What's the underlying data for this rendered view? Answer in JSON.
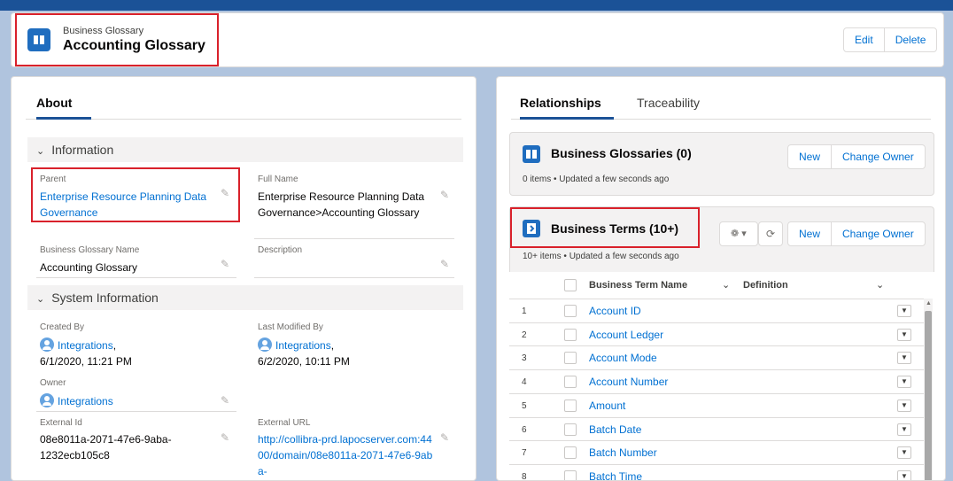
{
  "header": {
    "subtitle": "Business Glossary",
    "title": "Accounting Glossary",
    "edit_label": "Edit",
    "delete_label": "Delete"
  },
  "left": {
    "tab": "About",
    "information": {
      "heading": "Information",
      "parent_label": "Parent",
      "parent_value": "Enterprise Resource Planning Data Governance",
      "full_name_label": "Full Name",
      "full_name_value": "Enterprise Resource Planning Data Governance>Accounting Glossary",
      "glossary_name_label": "Business Glossary Name",
      "glossary_name_value": "Accounting Glossary",
      "description_label": "Description"
    },
    "system": {
      "heading": "System Information",
      "created_by_label": "Created By",
      "created_by_user": "Integrations",
      "created_by_date": "6/1/2020, 11:21 PM",
      "modified_by_label": "Last Modified By",
      "modified_by_user": "Integrations",
      "modified_by_date": "6/2/2020, 10:11 PM",
      "owner_label": "Owner",
      "owner_value": "Integrations",
      "external_id_label": "External Id",
      "external_id_value": "08e8011a-2071-47e6-9aba-1232ecb105c8",
      "external_url_label": "External URL",
      "external_url_value": "http://collibra-prd.lapocserver.com:4400/domain/08e8011a-2071-47e6-9aba-"
    }
  },
  "right": {
    "tabs": [
      "Relationships",
      "Traceability"
    ],
    "glossaries_card": {
      "title": "Business Glossaries (0)",
      "subtitle": "0 items • Updated a few seconds ago",
      "new_label": "New",
      "owner_label": "Change Owner"
    },
    "terms_card": {
      "title": "Business Terms (10+)",
      "subtitle": "10+ items • Updated a few seconds ago",
      "new_label": "New",
      "owner_label": "Change Owner"
    },
    "table": {
      "col_name": "Business Term Name",
      "col_definition": "Definition",
      "rows": [
        {
          "num": "1",
          "term": "Account ID"
        },
        {
          "num": "2",
          "term": "Account Ledger"
        },
        {
          "num": "3",
          "term": "Account Mode"
        },
        {
          "num": "4",
          "term": "Account Number"
        },
        {
          "num": "5",
          "term": "Amount"
        },
        {
          "num": "6",
          "term": "Batch Date"
        },
        {
          "num": "7",
          "term": "Batch Number"
        },
        {
          "num": "8",
          "term": "Batch Time"
        }
      ]
    }
  },
  "icons": {
    "header": "book-icon",
    "edit": "pencil-icon",
    "settings": "gear-icon",
    "refresh": "refresh-icon",
    "user": "user-avatar-icon"
  },
  "colors": {
    "brand": "#1b5297",
    "link": "#0070d2",
    "highlight": "#d9212b"
  }
}
